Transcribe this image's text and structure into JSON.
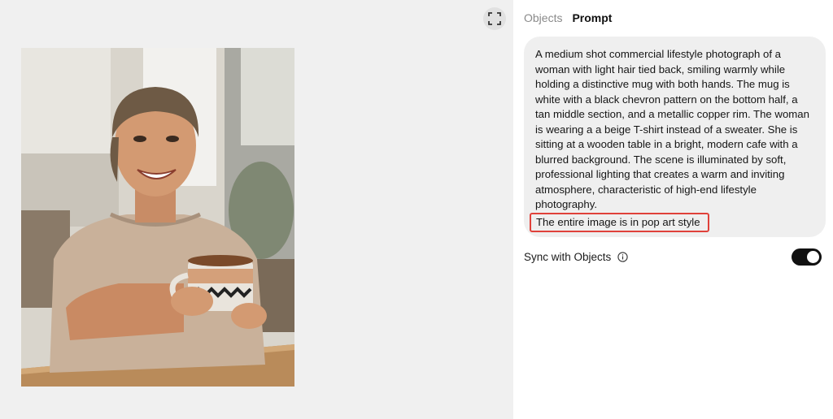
{
  "canvas": {
    "expand_icon": "expand-icon",
    "image_alt": "Woman holding a chevron-pattern mug at a cafe table"
  },
  "panel": {
    "tabs": [
      {
        "label": "Objects",
        "active": false
      },
      {
        "label": "Prompt",
        "active": true
      }
    ],
    "prompt": {
      "text": "A medium shot commercial lifestyle photograph of a woman with light hair tied back, smiling warmly while holding a distinctive mug with both hands. The mug is white with a black chevron pattern on the bottom half, a tan middle section, and a metallic copper rim. The woman is wearing a a beige T-shirt instead of a sweater. She is sitting at a wooden table in a bright, modern cafe with a blurred background. The scene is illuminated by soft, professional lighting that creates a warm and inviting atmosphere, characteristic of high-end lifestyle photography.",
      "highlighted": "The entire image is in pop art style",
      "highlight_color": "#e0413a"
    },
    "sync": {
      "label": "Sync with Objects",
      "info_icon": "info-icon",
      "enabled": true
    }
  }
}
